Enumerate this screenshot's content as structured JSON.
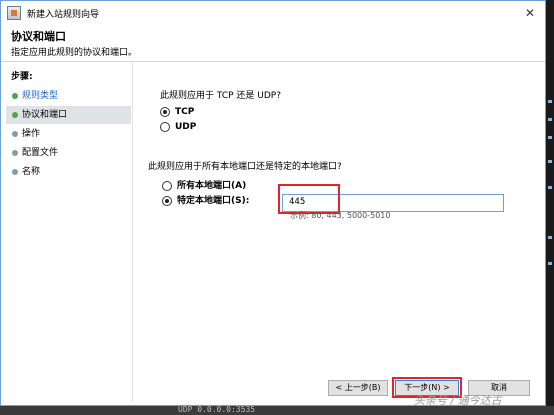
{
  "window": {
    "title": "新建入站规则向导"
  },
  "header": {
    "title": "协议和端口",
    "subtitle": "指定应用此规则的协议和端口。"
  },
  "sidebar": {
    "label": "步骤:",
    "items": [
      {
        "label": "规则类型"
      },
      {
        "label": "协议和端口"
      },
      {
        "label": "操作"
      },
      {
        "label": "配置文件"
      },
      {
        "label": "名称"
      }
    ]
  },
  "protocol": {
    "question": "此规则应用于 TCP 还是 UDP?",
    "options": [
      {
        "label": "TCP",
        "selected": true
      },
      {
        "label": "UDP",
        "selected": false
      }
    ]
  },
  "ports": {
    "question": "此规则应用于所有本地端口还是特定的本地端口?",
    "options": [
      {
        "label": "所有本地端口(A)",
        "selected": false
      },
      {
        "label": "特定本地端口(S):",
        "selected": true
      }
    ],
    "value": "445",
    "example": "示例: 80, 443, 5000-5010"
  },
  "buttons": {
    "back": "< 上一步(B)",
    "next": "下一步(N) >",
    "cancel": "取消"
  },
  "watermark": "头条号 / 通今达古",
  "background_text": "UDP     0.0.0.0:3535",
  "colors": {
    "accent": "#6f9fd8",
    "highlight": "#e0262a",
    "link": "#1f66c2"
  }
}
